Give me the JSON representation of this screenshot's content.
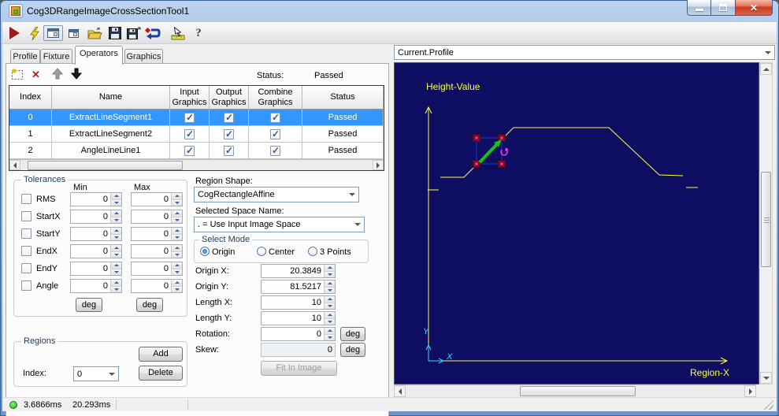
{
  "window": {
    "title": "Cog3DRangeImageCrossSectionTool1"
  },
  "toolbar": {
    "icons": [
      "run",
      "trigger-lightning",
      "show-controls",
      "float-window",
      "open-file",
      "save-file",
      "save-as",
      "reset",
      "pointer-ruler",
      "help"
    ]
  },
  "tabs": {
    "items": [
      "Profile",
      "Fixture",
      "Operators",
      "Graphics"
    ],
    "active": "Operators"
  },
  "operators": {
    "toolbar_icons": [
      "new-operator",
      "delete-operator",
      "move-up",
      "move-down"
    ],
    "status_label": "Status:",
    "status_value": "Passed",
    "table": {
      "headers": [
        "Index",
        "Name",
        "Input\nGraphics",
        "Output\nGraphics",
        "Combine\nGraphics",
        "Status"
      ],
      "rows": [
        {
          "index": "0",
          "name": "ExtractLineSegment1",
          "input_graphics": true,
          "output_graphics": true,
          "combine_graphics": true,
          "status": "Passed",
          "selected": true
        },
        {
          "index": "1",
          "name": "ExtractLineSegment2",
          "input_graphics": true,
          "output_graphics": true,
          "combine_graphics": true,
          "status": "Passed",
          "selected": false
        },
        {
          "index": "2",
          "name": "AngleLineLine1",
          "input_graphics": true,
          "output_graphics": true,
          "combine_graphics": true,
          "status": "Passed",
          "selected": false
        }
      ]
    }
  },
  "tolerances": {
    "title": "Tolerances",
    "min_header": "Min",
    "max_header": "Max",
    "deg_button": "deg",
    "rows": [
      {
        "label": "RMS",
        "min": "0",
        "max": "0",
        "checked": false
      },
      {
        "label": "StartX",
        "min": "0",
        "max": "0",
        "checked": false
      },
      {
        "label": "StartY",
        "min": "0",
        "max": "0",
        "checked": false
      },
      {
        "label": "EndX",
        "min": "0",
        "max": "0",
        "checked": false
      },
      {
        "label": "EndY",
        "min": "0",
        "max": "0",
        "checked": false
      },
      {
        "label": "Angle",
        "min": "0",
        "max": "0",
        "checked": false
      }
    ]
  },
  "region": {
    "shape_label": "Region Shape:",
    "shape_value": "CogRectangleAffine",
    "space_label": "Selected Space Name:",
    "space_value": ". = Use Input Image Space",
    "select_mode": {
      "title": "Select Mode",
      "options": [
        "Origin",
        "Center",
        "3 Points"
      ],
      "selected": "Origin"
    },
    "fields": [
      {
        "label": "Origin X:",
        "value": "20.3849",
        "spinner": true
      },
      {
        "label": "Origin Y:",
        "value": "81.5217",
        "spinner": true
      },
      {
        "label": "Length X:",
        "value": "10",
        "spinner": true
      },
      {
        "label": "Length Y:",
        "value": "10",
        "spinner": true
      },
      {
        "label": "Rotation:",
        "value": "0",
        "spinner": true,
        "unit": "deg"
      },
      {
        "label": "Skew:",
        "value": "0",
        "spinner": false,
        "unit": "deg",
        "disabled": true
      }
    ],
    "fit_button": "Fit In Image"
  },
  "regions": {
    "title": "Regions",
    "add_button": "Add",
    "delete_button": "Delete",
    "index_label": "Index:",
    "index_value": "0"
  },
  "profile_view": {
    "selector_value": "Current.Profile",
    "ylabel": "Height-Value",
    "xlabel": "Region-X",
    "mini_axis": {
      "x_label": "X",
      "y_label": "Y"
    },
    "colors": {
      "background": "#0d0d62",
      "profile": "#ffff3a",
      "axis": "#ffff3a",
      "mini_axis": "#3fd0ff",
      "region_outline": "#2233cc",
      "handle": "#7e1111",
      "handle_dot": "#ff2bff",
      "arrow": "#13c21f"
    },
    "profile_segments": [
      "42,161 56,161",
      "58,145 88,145 151,82 272,82 336,142 366,143",
      "370,158 385,158"
    ]
  },
  "status_bar": {
    "items": [
      "3.6866ms",
      "20.293ms"
    ]
  }
}
